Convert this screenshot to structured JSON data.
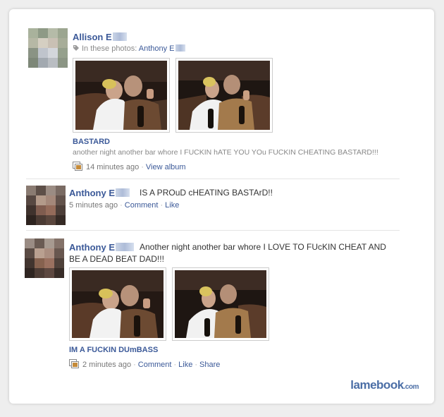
{
  "post1": {
    "author": "Allison E",
    "tag_label": "In these photos:",
    "tag_name": "Anthony E",
    "album_title": "BASTARD",
    "album_desc": "another night another bar whore I FUCKIN hATE YOU YOu FUCKIN CHEATING BASTARD!!!",
    "time": "14 minutes ago",
    "view_album": "View album"
  },
  "post2": {
    "author": "Anthony E",
    "status": "IS A PROuD cHEATING BASTArD!!",
    "time": "5 minutes ago",
    "comment": "Comment",
    "like": "Like"
  },
  "post3": {
    "author": "Anthony E",
    "status_line1": "Another night another bar whore I LOVE TO FUcKIN CHEAT AND",
    "status_line2": "BE A DEAD BEAT DAD!!!",
    "album_title": "IM A FUCKIN DUmBASS",
    "time": "2 minutes ago",
    "comment": "Comment",
    "like": "Like",
    "share": "Share"
  },
  "watermark": {
    "brand": "lamebook",
    "tld": ".com"
  },
  "colors": {
    "link": "#3b5998",
    "muted": "#8a8a8a",
    "brand": "#4b6ea6"
  },
  "icons": [
    "tag-icon",
    "photo-album-icon"
  ]
}
